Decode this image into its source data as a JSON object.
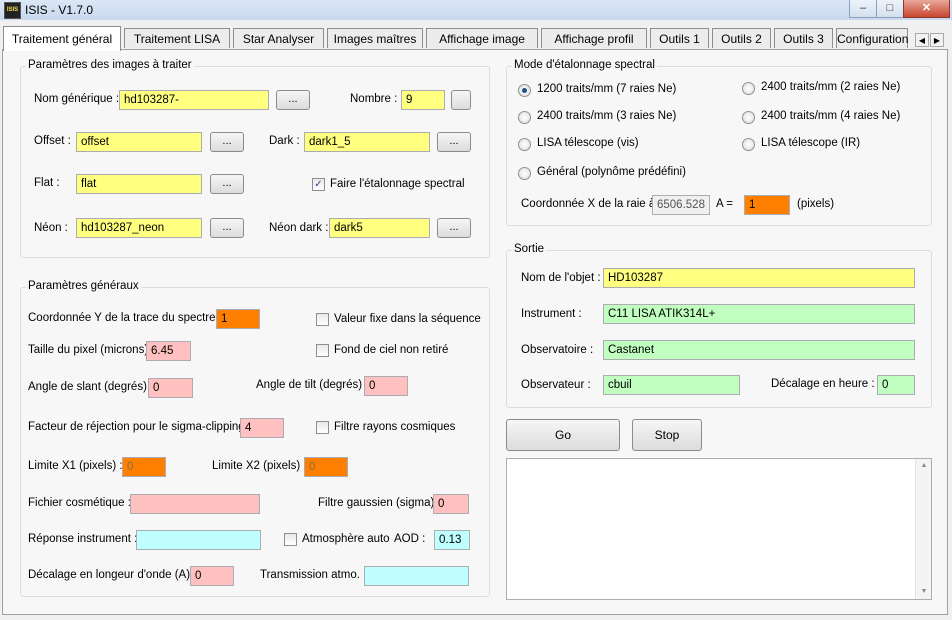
{
  "window": {
    "title": "ISIS - V1.7.0",
    "icon_text": "ISIS",
    "minimize": "–",
    "maximize": "□",
    "close": "✕"
  },
  "tabs": [
    {
      "label": "Traitement général",
      "active": true
    },
    {
      "label": "Traitement LISA"
    },
    {
      "label": "Star Analyser"
    },
    {
      "label": "Images maîtres"
    },
    {
      "label": "Affichage image"
    },
    {
      "label": "Affichage profil"
    },
    {
      "label": "Outils 1"
    },
    {
      "label": "Outils 2"
    },
    {
      "label": "Outils 3"
    },
    {
      "label": "Configuration"
    }
  ],
  "tab_scroll": {
    "left": "◀",
    "right": "▶"
  },
  "images": {
    "legend": "Paramètres des images à traiter",
    "nom_generique_label": "Nom générique :",
    "nom_generique_value": "hd103287-",
    "nombre_label": "Nombre :",
    "nombre_value": "9",
    "offset_label": "Offset :",
    "offset_value": "offset",
    "dark_label": "Dark :",
    "dark_value": "dark1_5",
    "flat_label": "Flat :",
    "flat_value": "flat",
    "etalonnage_label": "Faire l'étalonnage spectral",
    "etalonnage_checked": "✓",
    "neon_label": "Néon :",
    "neon_value": "hd103287_neon",
    "neon_dark_label": "Néon dark :",
    "neon_dark_value": "dark5",
    "browse": "..."
  },
  "mode": {
    "legend": "Mode d'étalonnage spectral",
    "options": [
      "1200 traits/mm (7 raies Ne)",
      "2400 traits/mm (2 raies Ne)",
      "2400 traits/mm (3 raies Ne)",
      "2400 traits/mm (4 raies Ne)",
      "LISA télescope (vis)",
      "LISA télescope (IR)",
      "Général (polynôme prédéfini)"
    ],
    "selected": "1200 traits/mm (7 raies Ne)",
    "coord_label": "Coordonnée X de la raie à",
    "coord_wavelength": "6506.528",
    "a_label": "A  =",
    "coord_value": "1",
    "pixels_label": "(pixels)"
  },
  "general": {
    "legend": "Paramètres généraux",
    "coord_y_label": "Coordonnée Y de la trace du spectre :",
    "coord_y_value": "1",
    "valeur_fixe_label": "Valeur fixe dans la séquence",
    "taille_pixel_label": "Taille du pixel (microns) :",
    "taille_pixel_value": "6.45",
    "fond_ciel_label": "Fond de ciel non retiré",
    "slant_label": "Angle de slant (degrés) :",
    "slant_value": "0",
    "tilt_label": "Angle de tilt (degrés) :",
    "tilt_value": "0",
    "rejection_label": "Facteur de réjection pour le sigma-clipping :",
    "rejection_value": "4",
    "filtre_cosmiques_label": "Filtre rayons cosmiques",
    "x1_label": "Limite X1 (pixels) :",
    "x1_value": "0",
    "x2_label": "Limite X2 (pixels) :",
    "x2_value": "0",
    "cosmetique_label": "Fichier cosmétique :",
    "cosmetique_value": "",
    "gaussien_label": "Filtre gaussien (sigma) :",
    "gaussien_value": "0",
    "reponse_label": "Réponse instrument :",
    "reponse_value": "",
    "atmo_auto_label": "Atmosphère auto",
    "aod_label": "AOD :",
    "aod_value": "0.13",
    "decalage_label": "Décalage en longeur d'onde (A) :",
    "decalage_value": "0",
    "transmission_label": "Transmission atmo. :",
    "transmission_value": ""
  },
  "sortie": {
    "legend": "Sortie",
    "objet_label": "Nom de l'objet :",
    "objet_value": "HD103287",
    "instrument_label": "Instrument :",
    "instrument_value": "C11 LISA ATIK314L+",
    "observatoire_label": "Observatoire :",
    "observatoire_value": "Castanet",
    "observateur_label": "Observateur :",
    "observateur_value": "cbuil",
    "decalage_heure_label": "Décalage en heure :",
    "decalage_heure_value": "0"
  },
  "actions": {
    "go": "Go",
    "stop": "Stop"
  },
  "log": {
    "text": "",
    "up": "▲",
    "down": "▼"
  },
  "colors": {
    "required": "#ffff80",
    "pixel": "#ff8000",
    "numeric": "#ffc0c0",
    "text": "#c0ffc0",
    "file": "#c0ffff"
  }
}
